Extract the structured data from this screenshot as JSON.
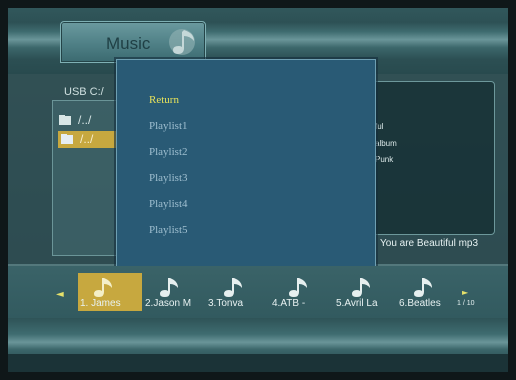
{
  "header": {
    "title": "Music"
  },
  "browser": {
    "path": "USB  C:/",
    "rows": [
      {
        "label": "/../",
        "selected": false
      },
      {
        "label": "/../",
        "selected": true
      }
    ]
  },
  "info": {
    "lines": [
      "ful",
      "album",
      "Punk"
    ],
    "now_playing": "You are Beautiful mp3"
  },
  "playlist_menu": {
    "items": [
      {
        "label": "Return",
        "active": true
      },
      {
        "label": "Playlist1",
        "active": false
      },
      {
        "label": "Playlist2",
        "active": false
      },
      {
        "label": "Playlist3",
        "active": false
      },
      {
        "label": "Playlist4",
        "active": false
      },
      {
        "label": "Playlist5",
        "active": false
      }
    ]
  },
  "thumbnails": {
    "items": [
      {
        "label": "1. James",
        "active": true
      },
      {
        "label": "2.Jason M",
        "active": false
      },
      {
        "label": "3.Tonva",
        "active": false
      },
      {
        "label": "4.ATB -",
        "active": false
      },
      {
        "label": "5.Avril La",
        "active": false
      },
      {
        "label": "6.Beatles",
        "active": false
      }
    ],
    "page": "1 / 10",
    "left_arrow": "◄",
    "right_arrow": "►"
  },
  "colors": {
    "highlight": "#c7a83f",
    "menu_bg": "#295a75",
    "active_text": "#e7e25a"
  }
}
